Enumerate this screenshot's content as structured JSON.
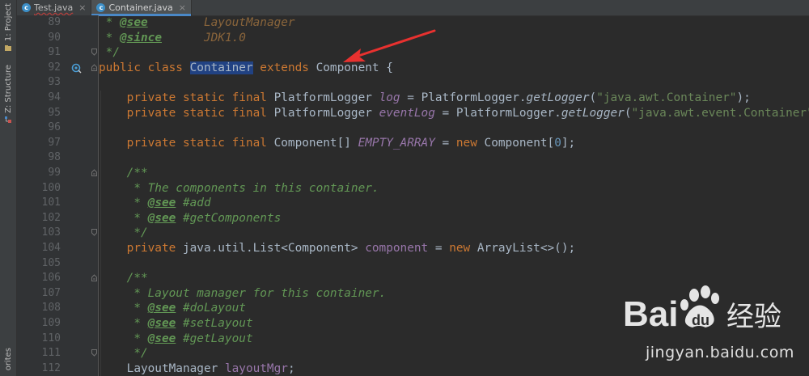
{
  "left_strip": {
    "project_label": "1: Project",
    "structure_label": "Z: Structure",
    "favorites_label": "orites"
  },
  "tabs": [
    {
      "label": "Test.java",
      "active": false,
      "icon": "java-class-icon",
      "close": "×"
    },
    {
      "label": "Container.java",
      "active": true,
      "icon": "java-class-icon",
      "close": "×"
    }
  ],
  "line_numbers": [
    "89",
    "90",
    "91",
    "92",
    "93",
    "94",
    "95",
    "96",
    "97",
    "98",
    "99",
    "100",
    "101",
    "102",
    "103",
    "104",
    "105",
    "106",
    "107",
    "108",
    "109",
    "110",
    "111",
    "112"
  ],
  "code": {
    "l89": {
      "star": " * ",
      "tag": "@see",
      "val": "        LayoutManager"
    },
    "l90": {
      "star": " * ",
      "tag": "@since",
      "val": "      JDK1.0"
    },
    "l91": {
      "text": " */"
    },
    "l92": {
      "kw1": "public class ",
      "cls": "Container",
      "kw2": " extends ",
      "rest": "Component {"
    },
    "l94": {
      "kw": "    private static final ",
      "type": "PlatformLogger ",
      "field": "log",
      "mid": " = PlatformLogger.",
      "meth": "getLogger",
      "open": "(",
      "str": "\"java.awt.Container\"",
      "close": ");"
    },
    "l95": {
      "kw": "    private static final ",
      "type": "PlatformLogger ",
      "field": "eventLog",
      "mid": " = PlatformLogger.",
      "meth": "getLogger",
      "open": "(",
      "str": "\"java.awt.event.Container\"",
      "close": ");"
    },
    "l97": {
      "kw": "    private static final ",
      "type": "Component[] ",
      "field": "EMPTY_ARRAY",
      "mid": " = ",
      "kw2": "new ",
      "type2": "Component[",
      "num": "0",
      "close": "];"
    },
    "l99": {
      "text": "    /**"
    },
    "l100": {
      "text": "     * The components in this container."
    },
    "l101": {
      "star": "     * ",
      "tag": "@see",
      "val": " #add"
    },
    "l102": {
      "star": "     * ",
      "tag": "@see",
      "val": " #getComponents"
    },
    "l103": {
      "text": "     */"
    },
    "l104": {
      "kw": "    private ",
      "type": "java.util.List<Component> ",
      "field": "component",
      "mid": " = ",
      "kw2": "new ",
      "rest": "ArrayList<>();"
    },
    "l106": {
      "text": "    /**"
    },
    "l107": {
      "text": "     * Layout manager for this container."
    },
    "l108": {
      "star": "     * ",
      "tag": "@see",
      "val": " #doLayout"
    },
    "l109": {
      "star": "     * ",
      "tag": "@see",
      "val": " #setLayout"
    },
    "l110": {
      "star": "     * ",
      "tag": "@see",
      "val": " #getLayout"
    },
    "l111": {
      "text": "     */"
    },
    "l112": {
      "type": "    LayoutManager ",
      "field": "layoutMgr",
      "rest": ";"
    }
  },
  "watermark": {
    "brand_latin": "Bai",
    "brand_tail": "经验",
    "site": "jingyan.baidu.com"
  },
  "colors": {
    "editor_bg": "#2b2b2b",
    "gutter_bg": "#313335",
    "keyword": "#cc7832",
    "string": "#6a8759",
    "field": "#9876aa",
    "doc": "#629755",
    "arrow": "#e8312f",
    "tab_underline": "#4a88c7"
  }
}
